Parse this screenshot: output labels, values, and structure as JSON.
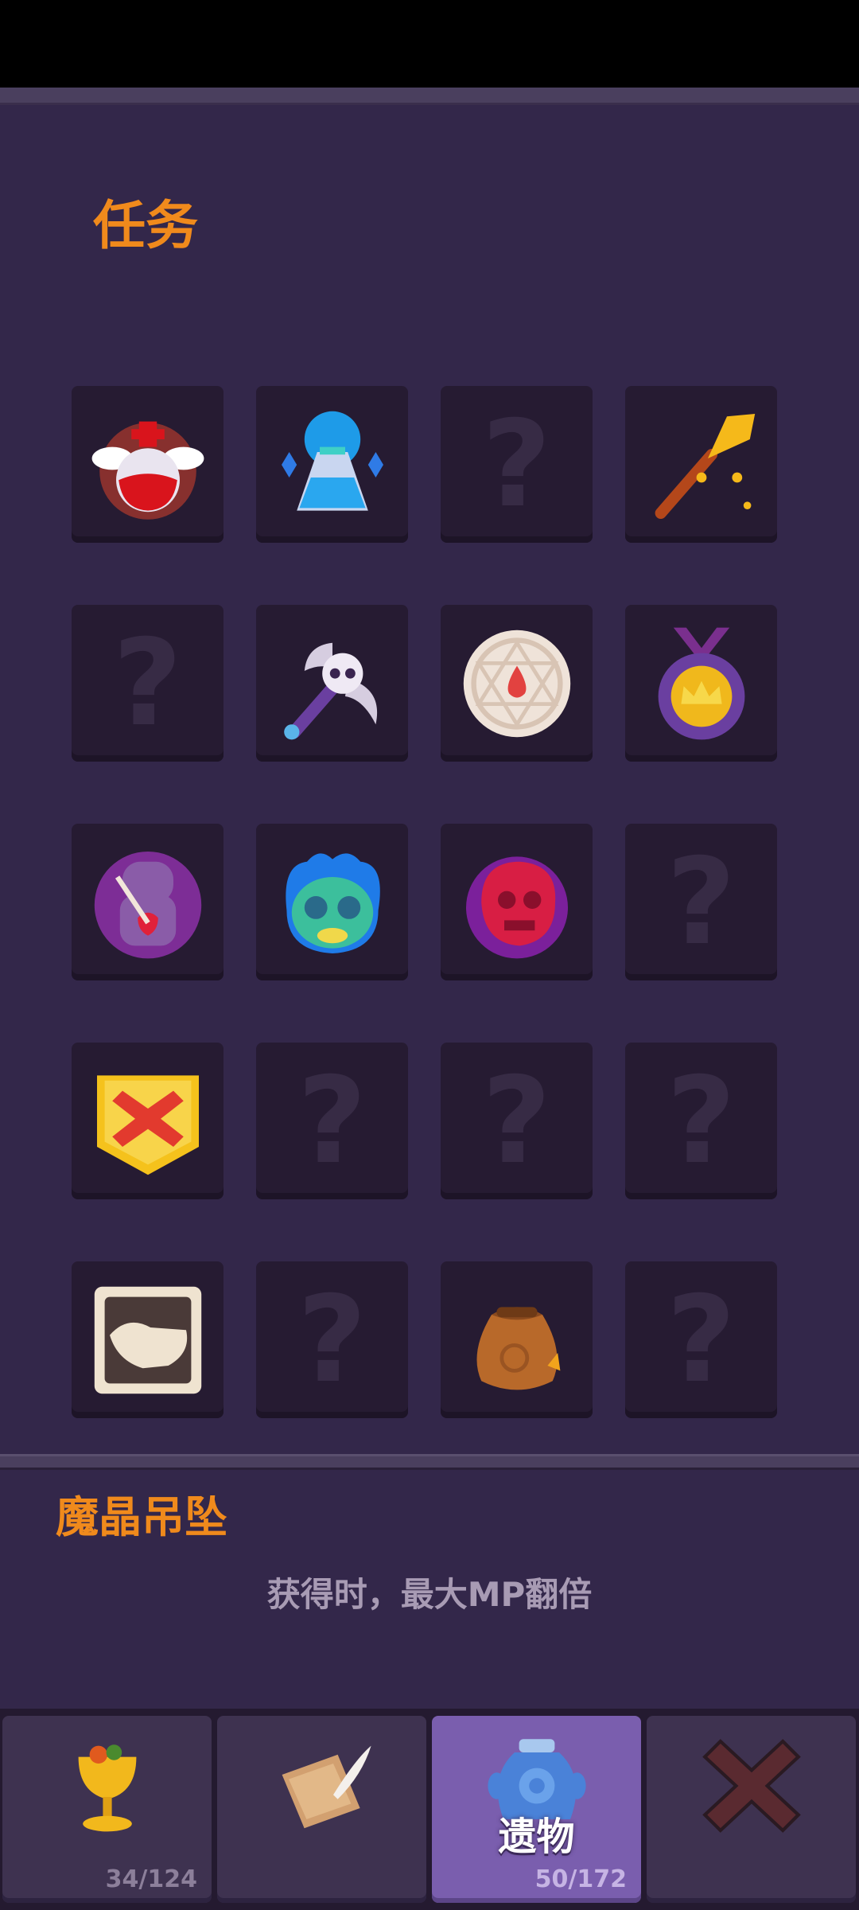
{
  "section": {
    "title": "任务"
  },
  "relic_grid": [
    {
      "icon": "angel-potion-icon",
      "unlocked": true
    },
    {
      "icon": "mana-flask-icon",
      "unlocked": true
    },
    {
      "icon": "unknown-relic-icon",
      "unlocked": false,
      "label": "?"
    },
    {
      "icon": "golden-spear-icon",
      "unlocked": true
    },
    {
      "icon": "unknown-relic-icon",
      "unlocked": false,
      "label": "?"
    },
    {
      "icon": "skull-axe-icon",
      "unlocked": true
    },
    {
      "icon": "rune-stone-icon",
      "unlocked": true
    },
    {
      "icon": "crown-medal-icon",
      "unlocked": true
    },
    {
      "icon": "voodoo-doll-icon",
      "unlocked": true
    },
    {
      "icon": "blue-flame-mask-icon",
      "unlocked": true
    },
    {
      "icon": "red-ghost-skull-icon",
      "unlocked": true
    },
    {
      "icon": "unknown-relic-icon",
      "unlocked": false,
      "label": "?"
    },
    {
      "icon": "shield-x-icon",
      "unlocked": true
    },
    {
      "icon": "unknown-relic-icon",
      "unlocked": false,
      "label": "?"
    },
    {
      "icon": "unknown-relic-icon",
      "unlocked": false,
      "label": "?"
    },
    {
      "icon": "unknown-relic-icon",
      "unlocked": false,
      "label": "?"
    },
    {
      "icon": "handshake-card-icon",
      "unlocked": true
    },
    {
      "icon": "unknown-relic-icon",
      "unlocked": false,
      "label": "?"
    },
    {
      "icon": "coin-sack-icon",
      "unlocked": true
    },
    {
      "icon": "unknown-relic-icon",
      "unlocked": false,
      "label": "?"
    }
  ],
  "selected_relic": {
    "name": "魔晶吊坠",
    "description": "获得时，最大MP翻倍"
  },
  "tabs": [
    {
      "icon": "golden-goblet-icon",
      "label": "",
      "count": "34/124",
      "active": false
    },
    {
      "icon": "scroll-quill-icon",
      "label": "",
      "count": "",
      "active": false
    },
    {
      "icon": "blue-urn-icon",
      "label": "遗物",
      "count": "50/172",
      "active": true
    },
    {
      "icon": "close-icon",
      "label": "",
      "count": "",
      "active": false
    }
  ],
  "colors": {
    "accent": "#f08a1c",
    "panel": "#33274a",
    "cell": "#261b32",
    "active_tab": "#7a5eae"
  }
}
